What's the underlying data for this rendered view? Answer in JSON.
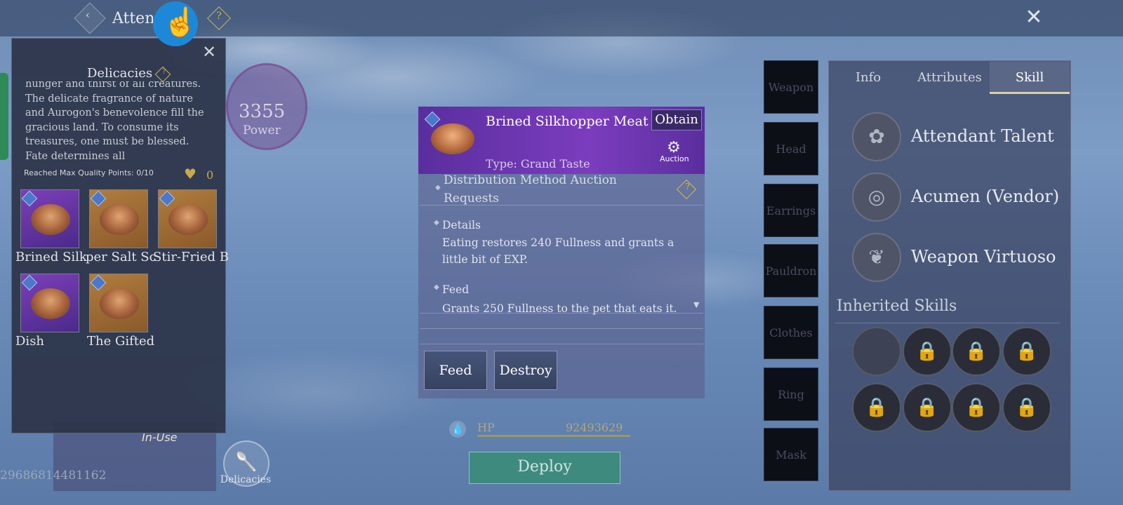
{
  "topbar": {
    "title": "Atten",
    "back_icon": "chevron-left-icon",
    "help_icon": "question-icon",
    "close_icon": "close-icon"
  },
  "background": {
    "uid": "29686814481162",
    "in_use_label": "In-Use",
    "delicacies_button_label": "Delicacies",
    "power_value": "3355",
    "power_label": "Power"
  },
  "delicacies_panel": {
    "title": "Delicacies",
    "description": "hunger and thirst of all creatures. The delicate fragrance of nature and Aurogon's benevolence fill the gracious land. To consume its treasures, one must be blessed. Fate determines all",
    "max_quality_text": "Reached Max Quality Points: 0/10",
    "hearts_count": "0",
    "items": [
      {
        "label": "Brined Silk",
        "rarity": "purple"
      },
      {
        "label": "per Salt Sc",
        "rarity": "orange"
      },
      {
        "label": "Stir-Fried B",
        "rarity": "orange"
      },
      {
        "label": "Dish",
        "rarity": "purple"
      },
      {
        "label": "The Gifted",
        "rarity": "orange"
      }
    ]
  },
  "item_detail": {
    "name": "Brined Silkhopper Meat",
    "obtain_label": "Obtain",
    "auction_label": "Auction",
    "type_text": "Type: Grand Taste",
    "distribution_text": "Distribution Method    Auction Requests",
    "details_title": "Details",
    "details_text": "Eating restores 240 Fullness and grants a little bit of EXP.",
    "feed_title": "Feed",
    "feed_text": "Grants 250 Fullness to the pet that eats it.",
    "feed_button": "Feed",
    "destroy_button": "Destroy"
  },
  "status": {
    "hp_label": "HP",
    "hp_value": "92493629",
    "deploy_label": "Deploy"
  },
  "equipment_slots": [
    "Weapon",
    "Head",
    "Earrings",
    "Pauldron",
    "Clothes",
    "Ring",
    "Mask"
  ],
  "right_panel": {
    "tabs": [
      "Info",
      "Attributes",
      "Skill"
    ],
    "active_tab": "Skill",
    "skills": [
      {
        "name": "Attendant Talent",
        "icon": "talent-icon"
      },
      {
        "name": "Acumen (Vendor)",
        "icon": "acumen-icon"
      },
      {
        "name": "Weapon Virtuoso",
        "icon": "weapon-virtuoso-icon"
      }
    ],
    "inherited_title": "Inherited Skills",
    "inherited_slots": [
      "empty",
      "locked",
      "locked",
      "locked",
      "locked",
      "locked",
      "locked",
      "locked"
    ]
  },
  "colors": {
    "rarity_purple": "#7c3fb8",
    "rarity_orange": "#b07d3e",
    "deploy_green": "#3f8a7f",
    "accent_gold": "#c9b25a"
  }
}
